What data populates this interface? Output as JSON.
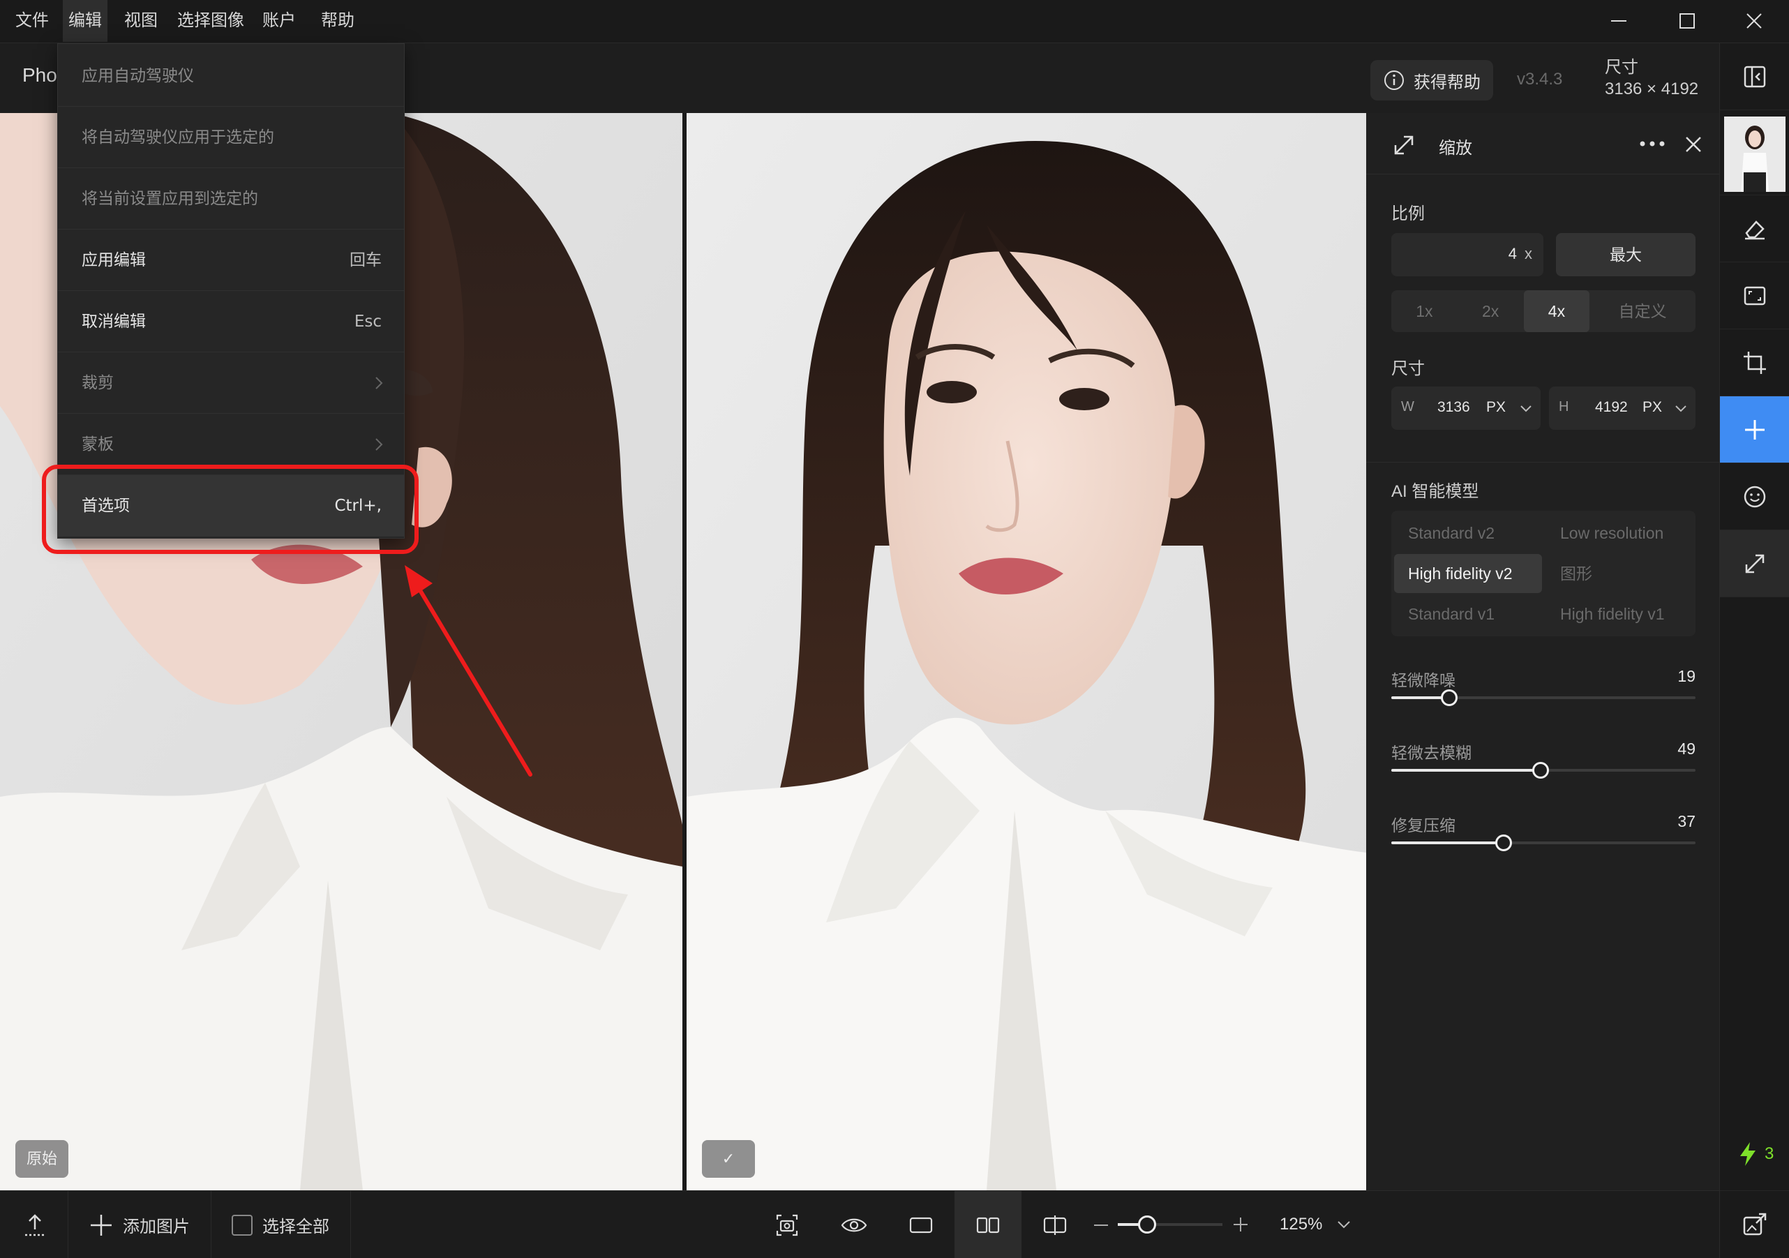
{
  "menubar": {
    "items": [
      "文件",
      "编辑",
      "视图",
      "选择图像",
      "账户",
      "帮助"
    ],
    "active_index": 1
  },
  "toolbar": {
    "brand_partial": "Pho",
    "help_label": "获得帮助",
    "version": "v3.4.3",
    "size_label": "尺寸",
    "size_value": "3136 × 4192"
  },
  "edit_menu": {
    "items": [
      {
        "label": "应用自动驾驶仪",
        "shortcut": "",
        "dim": true
      },
      {
        "label": "将自动驾驶仪应用于选定的",
        "shortcut": "",
        "dim": true
      },
      {
        "label": "将当前设置应用到选定的",
        "shortcut": "",
        "dim": true
      },
      {
        "label": "应用编辑",
        "shortcut": "回车",
        "dim": false
      },
      {
        "label": "取消编辑",
        "shortcut": "Esc",
        "dim": false
      },
      {
        "label": "裁剪",
        "shortcut": "",
        "dim": true,
        "submenu": true
      },
      {
        "label": "蒙板",
        "shortcut": "",
        "dim": true,
        "submenu": true
      },
      {
        "label": "首选项",
        "shortcut": "Ctrl+,",
        "dim": false,
        "highlighted": true
      }
    ]
  },
  "canvas": {
    "left_badge": "原始",
    "right_badge": "✓"
  },
  "panel": {
    "title": "缩放",
    "ratio_label": "比例",
    "ratio_value": "4",
    "ratio_unit": "x",
    "max_label": "最大",
    "scale_options": [
      "1x",
      "2x",
      "4x",
      "自定义"
    ],
    "scale_selected": 2,
    "dimension_label": "尺寸",
    "width_key": "W",
    "width_value": "3136",
    "height_key": "H",
    "height_value": "4192",
    "unit": "PX",
    "ai_model_label": "AI 智能模型",
    "models": [
      "Standard v2",
      "Low resolution",
      "High fidelity v2",
      "图形",
      "Standard v1",
      "High fidelity v1"
    ],
    "model_selected": 2,
    "sliders": [
      {
        "label": "轻微降噪",
        "value": 19,
        "max": 100
      },
      {
        "label": "轻微去模糊",
        "value": 49,
        "max": 100
      },
      {
        "label": "修复压缩",
        "value": 37,
        "max": 100
      }
    ]
  },
  "rail": {
    "credits": "3",
    "accent": "#3f8cf3"
  },
  "bottombar": {
    "add_image_label": "添加图片",
    "select_all_label": "选择全部",
    "zoom_value": "125%",
    "zoom_level": 0.28
  },
  "colors": {
    "annotation": "#ee1c1c",
    "credit_bolt": "#7ee02a"
  }
}
